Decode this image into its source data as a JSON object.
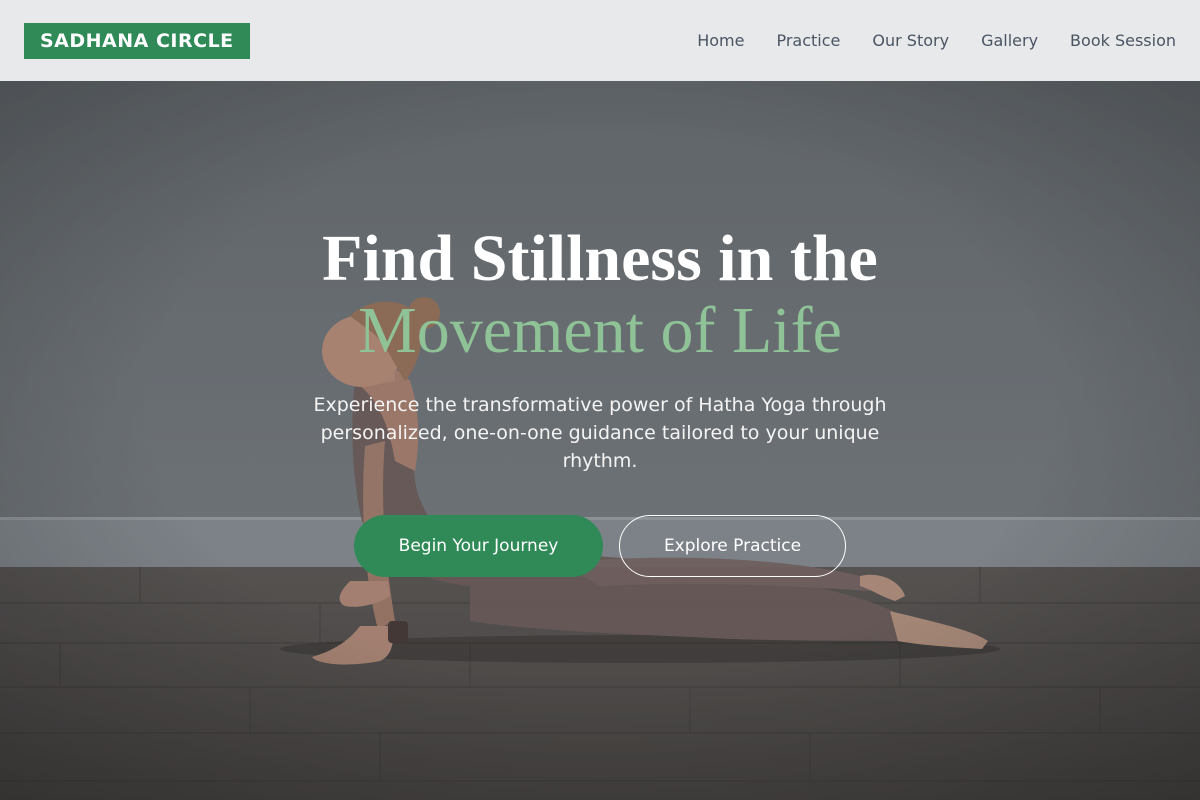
{
  "header": {
    "logo": "SADHANA CIRCLE",
    "nav": [
      {
        "label": "Home"
      },
      {
        "label": "Practice"
      },
      {
        "label": "Our Story"
      },
      {
        "label": "Gallery"
      },
      {
        "label": "Book Session"
      }
    ]
  },
  "hero": {
    "title_line1": "Find Stillness in the",
    "title_line2": "Movement of Life",
    "subtitle": "Experience the transformative power of Hatha Yoga through personalized, one-on-one guidance tailored to your unique rhythm.",
    "primary_cta": "Begin Your Journey",
    "secondary_cta": "Explore Practice",
    "image_subject": "woman-in-cobra-pose-on-wood-floor"
  },
  "colors": {
    "brand_green": "#2f8a57",
    "accent_light_green": "#8fc296",
    "header_bg": "#e8e9eb",
    "nav_text": "#4a5563"
  }
}
